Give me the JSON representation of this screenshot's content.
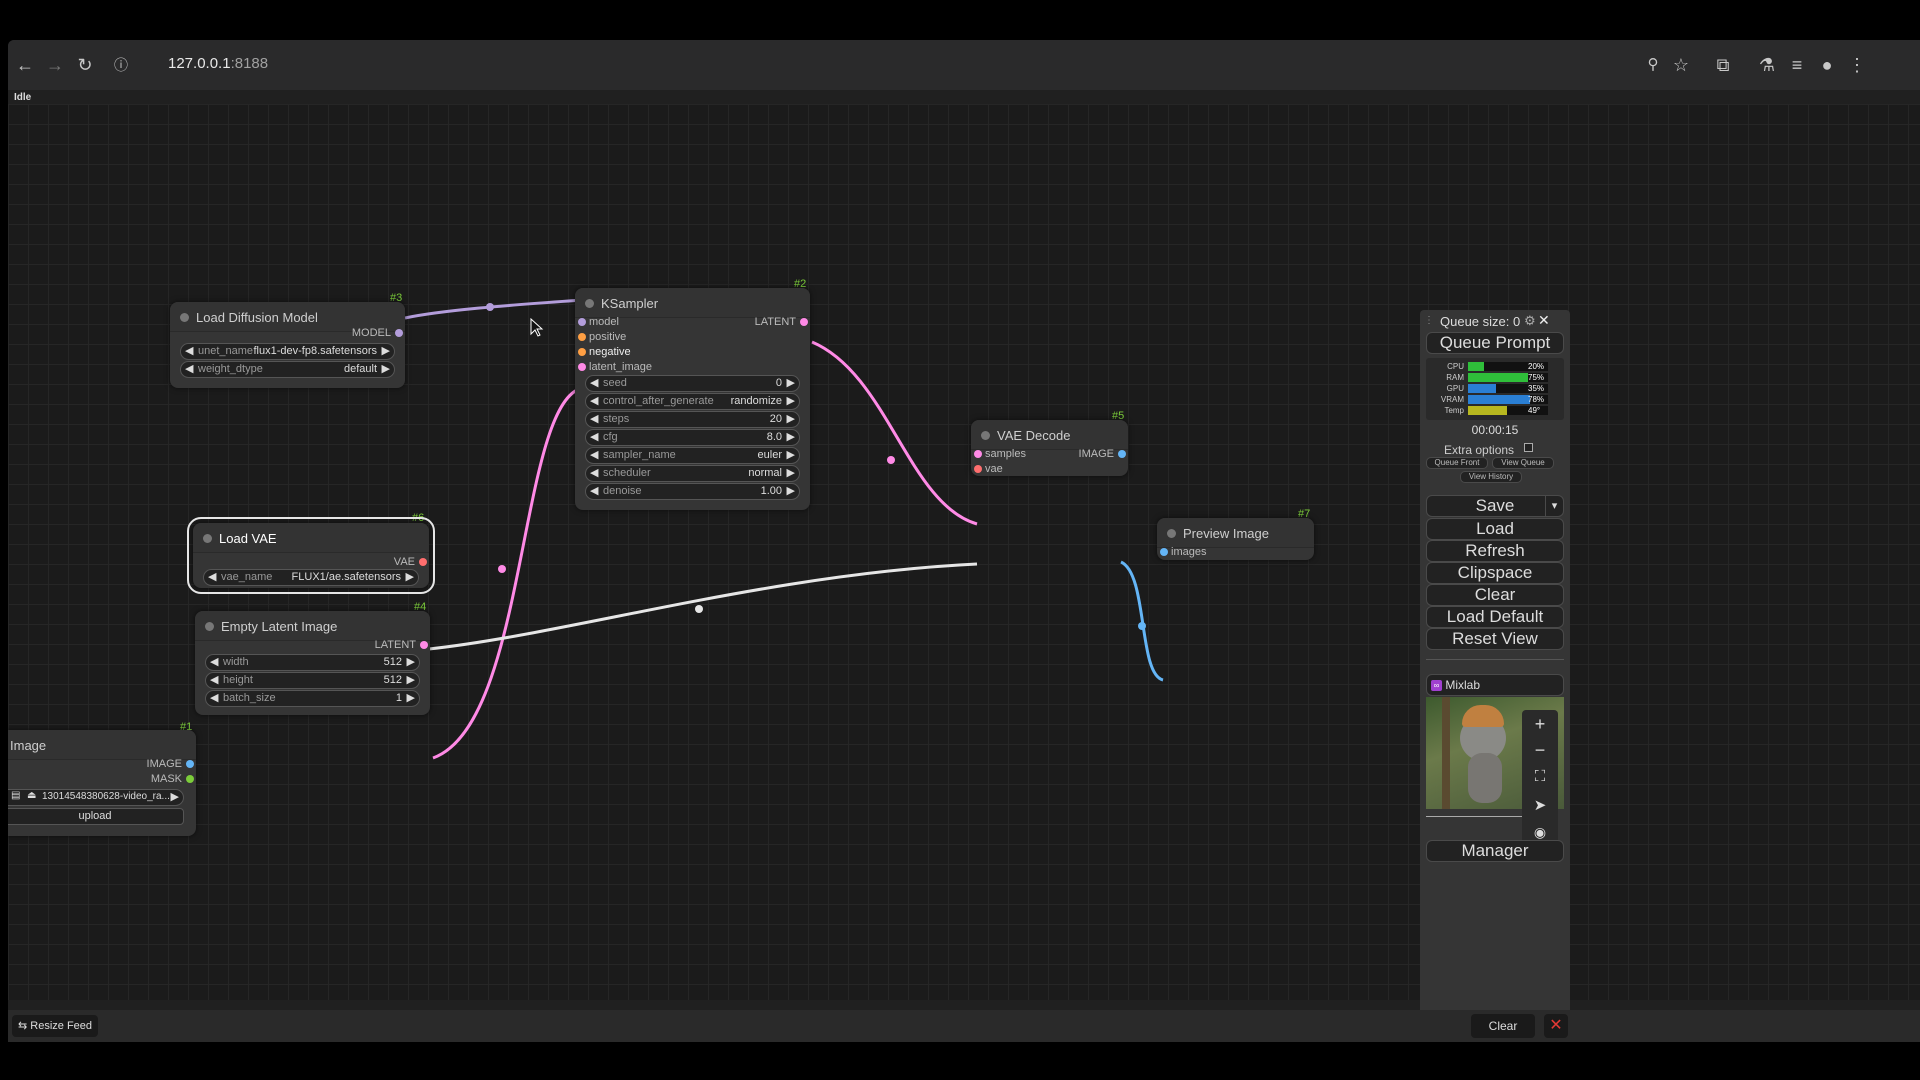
{
  "browser": {
    "url_host": "127.0.0.1",
    "url_port": ":8188",
    "status": "Idle"
  },
  "nodes": {
    "load_diffusion": {
      "id": "#3",
      "title": "Load Diffusion Model",
      "output": "MODEL",
      "widgets": [
        {
          "label": "unet_name",
          "value": "flux1-dev-fp8.safetensors"
        },
        {
          "label": "weight_dtype",
          "value": "default"
        }
      ]
    },
    "ksampler": {
      "id": "#2",
      "title": "KSampler",
      "inputs": [
        "model",
        "positive",
        "negative",
        "latent_image"
      ],
      "output": "LATENT",
      "widgets": [
        {
          "label": "seed",
          "value": "0"
        },
        {
          "label": "control_after_generate",
          "value": "randomize"
        },
        {
          "label": "steps",
          "value": "20"
        },
        {
          "label": "cfg",
          "value": "8.0"
        },
        {
          "label": "sampler_name",
          "value": "euler"
        },
        {
          "label": "scheduler",
          "value": "normal"
        },
        {
          "label": "denoise",
          "value": "1.00"
        }
      ]
    },
    "vae_decode": {
      "id": "#5",
      "title": "VAE Decode",
      "inputs": [
        "samples",
        "vae"
      ],
      "output": "IMAGE"
    },
    "preview": {
      "id": "#7",
      "title": "Preview Image",
      "inputs": [
        "images"
      ]
    },
    "load_vae": {
      "id": "#6",
      "title": "Load VAE",
      "output": "VAE",
      "widgets": [
        {
          "label": "vae_name",
          "value": "FLUX1/ae.safetensors"
        }
      ]
    },
    "empty_latent": {
      "id": "#4",
      "title": "Empty Latent Image",
      "output": "LATENT",
      "widgets": [
        {
          "label": "width",
          "value": "512"
        },
        {
          "label": "height",
          "value": "512"
        },
        {
          "label": "batch_size",
          "value": "1"
        }
      ]
    },
    "image": {
      "id": "#1",
      "title": "Image",
      "outputs": [
        "IMAGE",
        "MASK"
      ],
      "file": "13014548380628-video_ra...",
      "upload": "upload"
    }
  },
  "panel": {
    "queue_size": "Queue size: 0",
    "queue_prompt": "Queue Prompt",
    "monitor": [
      {
        "k": "CPU",
        "pct": "20%",
        "value": 0.2,
        "color": "#2fbf3a"
      },
      {
        "k": "RAM",
        "pct": "75%",
        "value": 0.75,
        "color": "#2fbf3a"
      },
      {
        "k": "GPU",
        "pct": "35%",
        "value": 0.35,
        "color": "#2a7fd4"
      },
      {
        "k": "VRAM",
        "pct": "78%",
        "value": 0.78,
        "color": "#2a7fd4"
      },
      {
        "k": "Temp",
        "pct": "49°",
        "value": 0.49,
        "color": "#b8b820"
      }
    ],
    "timer": "00:00:15",
    "extra_options": "Extra options",
    "queue_front": "Queue Front",
    "view_queue": "View Queue",
    "view_history": "View History",
    "buttons": [
      "Save",
      "Load",
      "Refresh",
      "Clipspace",
      "Clear",
      "Load Default",
      "Reset View"
    ],
    "mixlab": "Mixlab",
    "manager": "Manager"
  },
  "bottom": {
    "resize_feed": "Resize Feed",
    "clear": "Clear"
  },
  "colors": {
    "model": "#b39ddb",
    "latent": "#ff8ae6",
    "vae": "#ff6e6e",
    "image": "#64b5f6",
    "clip": "#ffd500"
  }
}
